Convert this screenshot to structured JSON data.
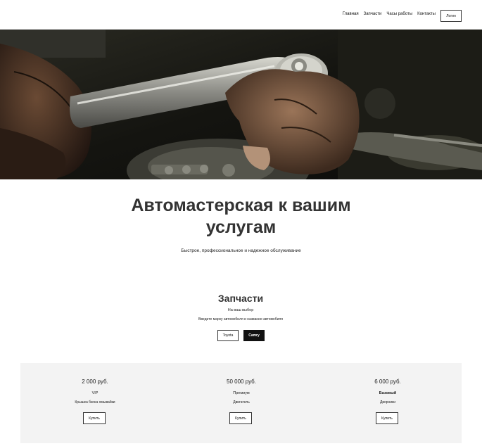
{
  "header": {
    "nav": [
      "Главная",
      "Запчасти",
      "Часы работы",
      "Контакты"
    ],
    "login_label": "Логин"
  },
  "hero": {
    "title": "Автомастерская к вашим услугам",
    "subtitle": "Быстрое, профессиональное и надежное обслуживание"
  },
  "parts": {
    "title": "Запчасти",
    "subtitle": "На ваш выбор",
    "hint": "Введите марку автомобиля и название автомобиля",
    "buttons": [
      "Toyota",
      "Camry"
    ]
  },
  "pricing": [
    {
      "price": "2 000 руб.",
      "tier": "VIP",
      "desc": "Крышка бачка омывайки",
      "buy": "Купить",
      "bold": false
    },
    {
      "price": "50 000 руб.",
      "tier": "Премиум",
      "desc": "Двигатель",
      "buy": "Купить",
      "bold": false
    },
    {
      "price": "6 000 руб.",
      "tier": "Базовый",
      "desc": "Дворники",
      "buy": "Купить",
      "bold": true
    }
  ]
}
